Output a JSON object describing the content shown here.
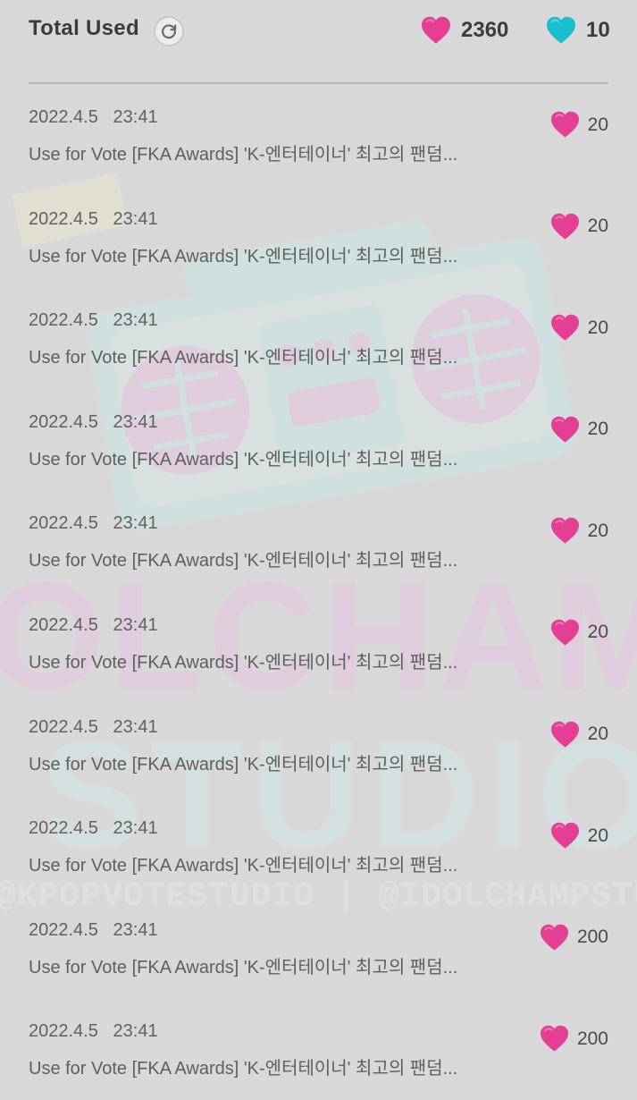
{
  "header": {
    "title": "Total Used",
    "refresh_icon": "refresh-icon",
    "pink_total": "2360",
    "cyan_total": "10"
  },
  "colors": {
    "background": "#d8d8d8",
    "pink_heart": "#e43e95",
    "cyan_heart": "#18bfd0",
    "divider": "#b7b7b7",
    "text_primary": "#3b3b3b",
    "text_secondary": "#5f5f5f"
  },
  "watermark": {
    "line1": "OLCHAMP",
    "line2": "STUDIO",
    "line3": "@KPOPVOTESTUDIO | @IDOLCHAMPSTUDIO"
  },
  "entries": [
    {
      "date": "2022.4.5",
      "time": "23:41",
      "description": "Use for Vote [FKA Awards] 'K-엔터테이너' 최고의 팬덤...",
      "amount": "20"
    },
    {
      "date": "2022.4.5",
      "time": "23:41",
      "description": "Use for Vote [FKA Awards] 'K-엔터테이너' 최고의 팬덤...",
      "amount": "20"
    },
    {
      "date": "2022.4.5",
      "time": "23:41",
      "description": "Use for Vote [FKA Awards] 'K-엔터테이너' 최고의 팬덤...",
      "amount": "20"
    },
    {
      "date": "2022.4.5",
      "time": "23:41",
      "description": "Use for Vote [FKA Awards] 'K-엔터테이너' 최고의 팬덤...",
      "amount": "20"
    },
    {
      "date": "2022.4.5",
      "time": "23:41",
      "description": "Use for Vote [FKA Awards] 'K-엔터테이너' 최고의 팬덤...",
      "amount": "20"
    },
    {
      "date": "2022.4.5",
      "time": "23:41",
      "description": "Use for Vote [FKA Awards] 'K-엔터테이너' 최고의 팬덤...",
      "amount": "20"
    },
    {
      "date": "2022.4.5",
      "time": "23:41",
      "description": "Use for Vote [FKA Awards] 'K-엔터테이너' 최고의 팬덤...",
      "amount": "20"
    },
    {
      "date": "2022.4.5",
      "time": "23:41",
      "description": "Use for Vote [FKA Awards] 'K-엔터테이너' 최고의 팬덤...",
      "amount": "20"
    },
    {
      "date": "2022.4.5",
      "time": "23:41",
      "description": "Use for Vote [FKA Awards] 'K-엔터테이너' 최고의 팬덤...",
      "amount": "200"
    },
    {
      "date": "2022.4.5",
      "time": "23:41",
      "description": "Use for Vote [FKA Awards] 'K-엔터테이너' 최고의 팬덤...",
      "amount": "200"
    }
  ]
}
